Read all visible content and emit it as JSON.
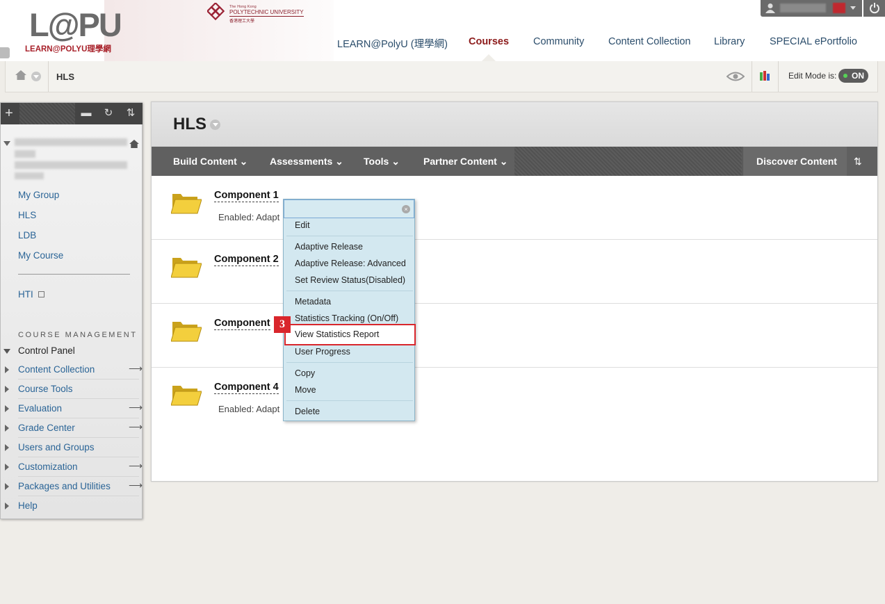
{
  "header": {
    "logo_main": "L@PU",
    "logo_sub": "LEARN@POLYU理學網",
    "univ_small": "The Hong Kong",
    "univ_name": "POLYTECHNIC UNIVERSITY",
    "univ_chinese": "香港理工大學",
    "nav": [
      {
        "label": "LEARN@PolyU (理學網)"
      },
      {
        "label": "Courses"
      },
      {
        "label": "Community"
      },
      {
        "label": "Content Collection"
      },
      {
        "label": "Library"
      },
      {
        "label": "SPECIAL ePortfolio"
      }
    ],
    "active_nav": "Courses"
  },
  "breadcrumb": {
    "title": "HLS",
    "edit_mode_label": "Edit Mode is:",
    "edit_mode_value": "ON"
  },
  "sidebar": {
    "links": [
      {
        "label": "My Group"
      },
      {
        "label": "HLS"
      },
      {
        "label": "LDB"
      },
      {
        "label": "My Course"
      }
    ],
    "hti": "HTI",
    "course_management": "COURSE MANAGEMENT",
    "control_panel": "Control Panel",
    "tools": [
      {
        "label": "Content Collection",
        "arrow": "⟶"
      },
      {
        "label": "Course Tools",
        "arrow": ""
      },
      {
        "label": "Evaluation",
        "arrow": "⟶"
      },
      {
        "label": "Grade Center",
        "arrow": "⟶"
      },
      {
        "label": "Users and Groups",
        "arrow": ""
      },
      {
        "label": "Customization",
        "arrow": "⟶"
      },
      {
        "label": "Packages and Utilities",
        "arrow": "⟶"
      },
      {
        "label": "Help",
        "arrow": ""
      }
    ]
  },
  "main": {
    "title": "HLS",
    "toolbar": {
      "build": "Build Content",
      "assess": "Assessments",
      "tools": "Tools",
      "partner": "Partner Content",
      "discover": "Discover Content"
    },
    "items": [
      {
        "name": "Component 1",
        "status": "Enabled:  Adapt"
      },
      {
        "name": "Component 2",
        "status": ""
      },
      {
        "name": "Component",
        "status": ""
      },
      {
        "name": "Component 4",
        "status": "Enabled:  Adapt"
      }
    ]
  },
  "context_menu": {
    "items": [
      "Edit",
      "Adaptive Release",
      "Adaptive Release: Advanced",
      "Set Review Status(Disabled)",
      "Metadata",
      "Statistics Tracking (On/Off)",
      "View Statistics Report",
      "User Progress",
      "Copy",
      "Move",
      "Delete"
    ],
    "highlighted": "View Statistics Report",
    "step_badge": "3"
  },
  "colors": {
    "accent": "#8c1a1a",
    "link": "#2a6496",
    "highlight": "#d9262c",
    "menu_bg": "#d3e8f0"
  }
}
